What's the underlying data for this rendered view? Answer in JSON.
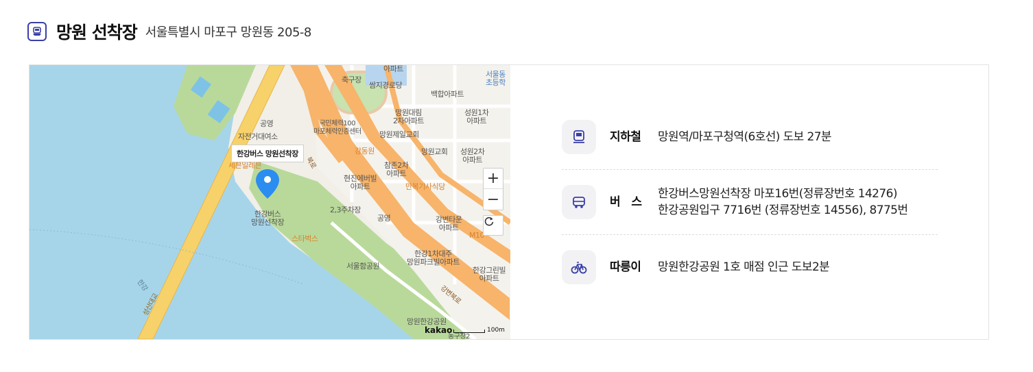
{
  "header": {
    "title": "망원 선착장",
    "address": "서울특별시 마포구 망원동 205-8"
  },
  "map": {
    "pin_label": "한강버스 망원선착장",
    "zoom_in": "+",
    "zoom_out": "−",
    "logo": "kakao",
    "scale": "100m",
    "labels": {
      "l1": "아파트",
      "l2": "축구장",
      "l3": "쌈지경로당",
      "l4": "서울동\n초등학",
      "l5": "백합아파트",
      "l6": "망원대림\n2차아파트",
      "l7": "성원1차\n아파트",
      "l8": "국민체력100\n마포체력인증센터",
      "l9": "망원제일교회",
      "l10": "공영",
      "l11": "자전거대여소",
      "l12": "강동원",
      "l13": "망원교회",
      "l14": "성원2차\n아파트",
      "l15": "참존2차\n아파트",
      "l16": "세븐일레븐",
      "l17": "현진에버빌\n아파트",
      "l18": "만복기사식당",
      "l19": "한강버스\n망원선착장",
      "l20": "2,3주차장",
      "l21": "공영",
      "l22": "강변타운\n아파트",
      "l23": "스타벅스",
      "l24": "M10",
      "l25": "한강1차대주\n망원파크빌아파트",
      "l26": "서울함공원",
      "l27": "한강그린빌\n아파트",
      "l28": "한강",
      "l29": "성산대교",
      "l30": "망원한강공원",
      "l31": "농구장2",
      "l32": "강변북로",
      "l33": "북로"
    }
  },
  "info": {
    "subway": {
      "label": "지하철",
      "text": "망원역/마포구청역(6호선) 도보 27분"
    },
    "bus": {
      "label": "버   스",
      "line1": "한강버스망원선착장 마포16번(정류장번호 14276)",
      "line2": "한강공원입구 7716번 (정류장번호 14556), 8775번"
    },
    "bike": {
      "label": "따릉이",
      "text": "망원한강공원 1호 매점 인근 도보2분"
    }
  },
  "colors": {
    "accent": "#3a3fa8",
    "river": "#a6d5ea",
    "park": "#b9d99b",
    "road": "#f7b46a",
    "pin": "#2b8df0"
  }
}
